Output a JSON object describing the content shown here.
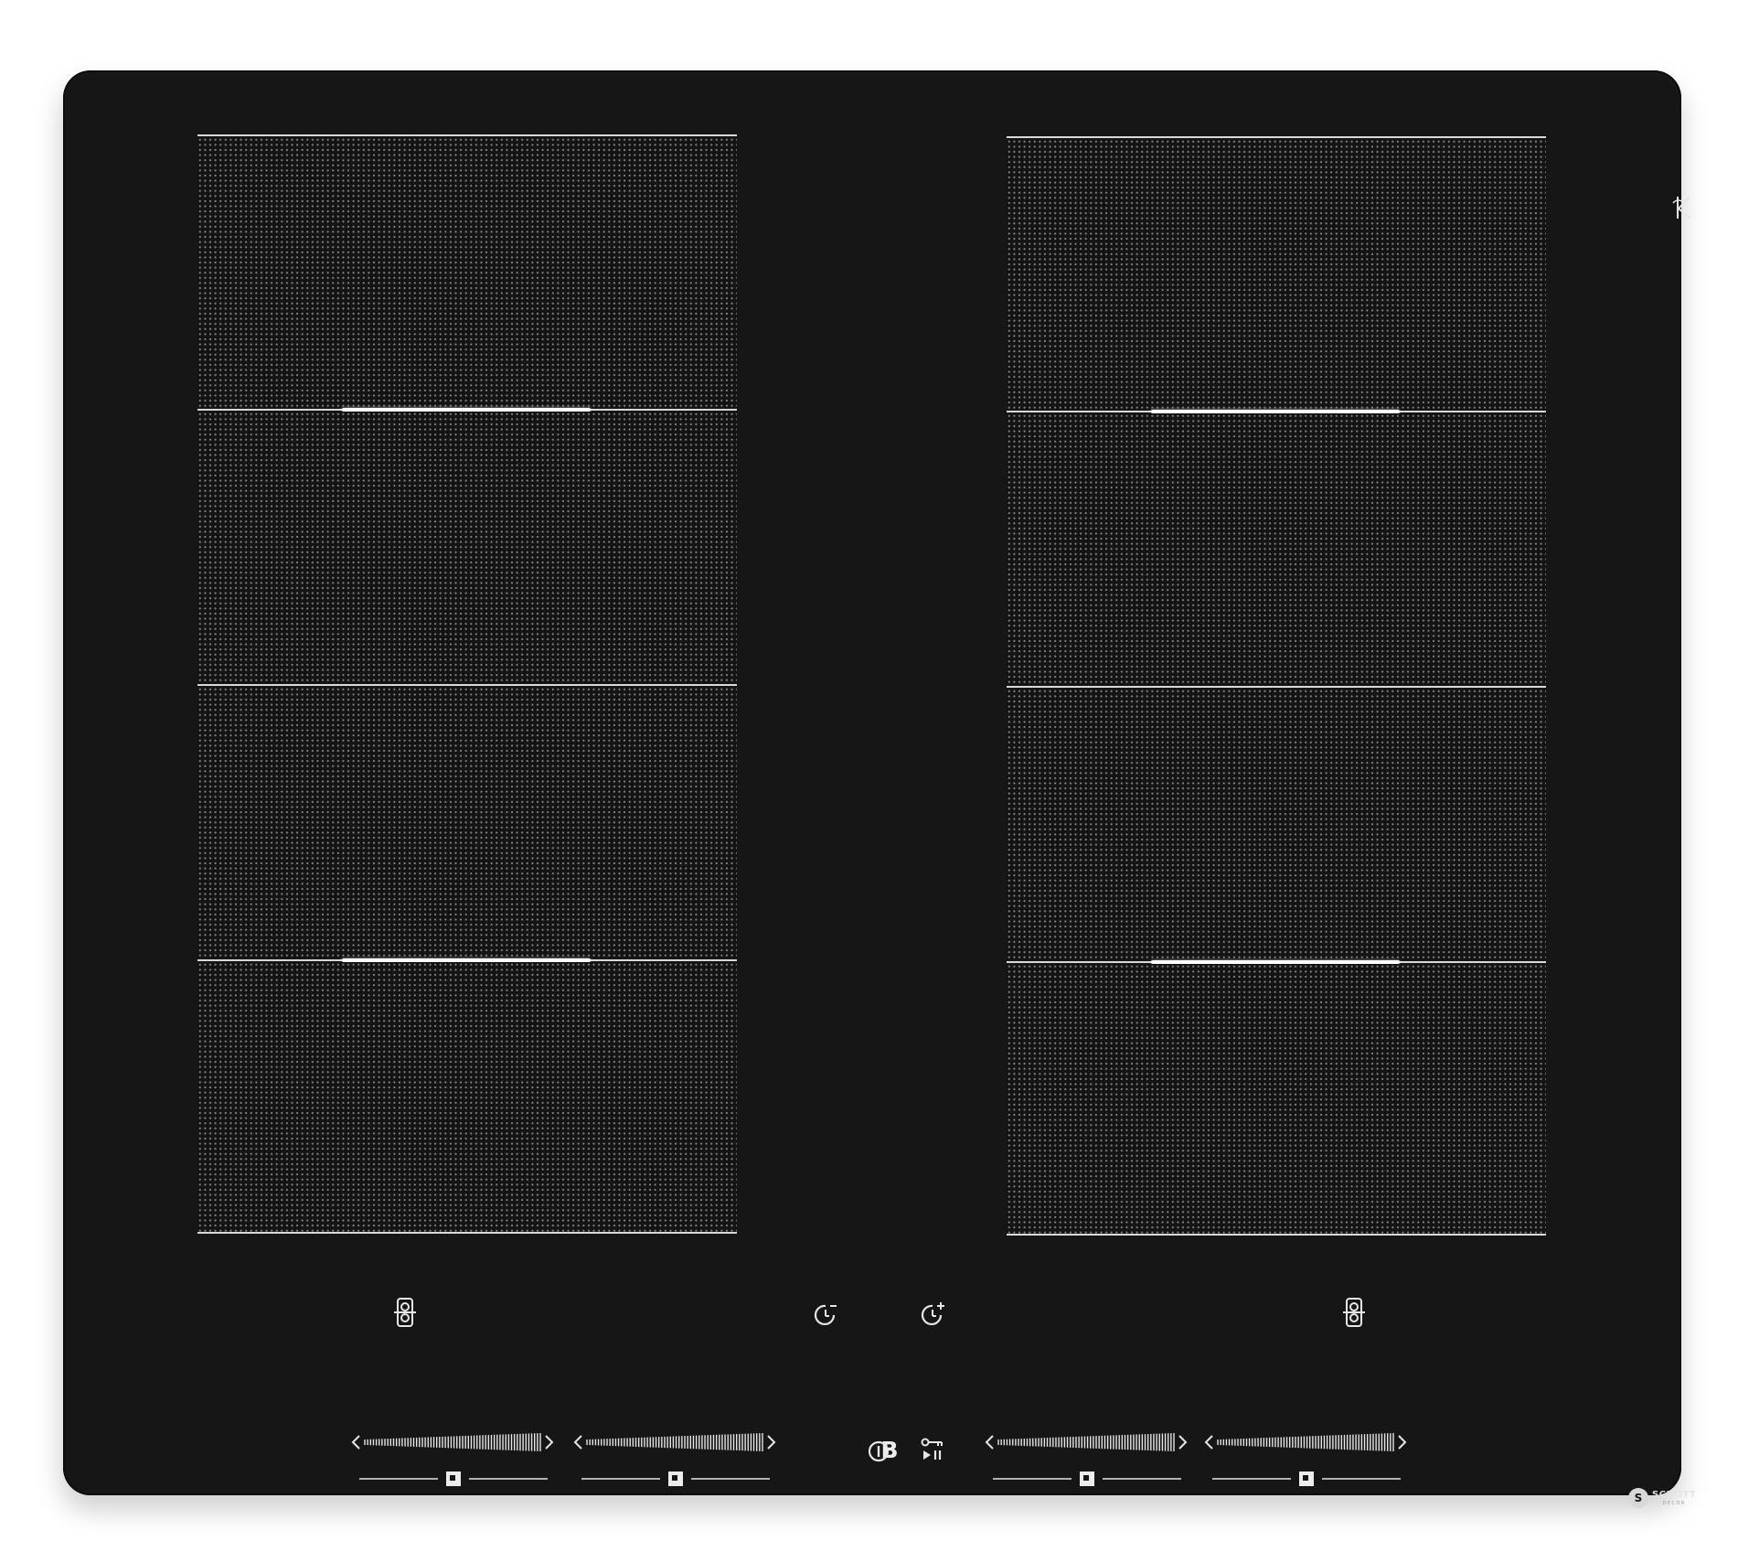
{
  "cooktop": {
    "surface_color": "#161616",
    "print_color": "#e6e6e6",
    "left_column": {
      "zone_count": 4,
      "bridge_marks_between_zones": [
        1,
        3
      ]
    },
    "right_column": {
      "zone_count": 4,
      "bridge_marks_between_zones": [
        1,
        3
      ]
    }
  },
  "controls": {
    "left_bridge_icon": "zone-bridge-icon",
    "right_bridge_icon": "zone-bridge-icon",
    "timer_minus_icon": "timer-minus-icon",
    "timer_plus_icon": "timer-plus-icon",
    "bridge_button_label": "B",
    "power_icon": "power-icon",
    "lock_pause_icon": "key-lock-play-pause-icon",
    "sliders": [
      {
        "name": "slider-zone-1",
        "left_arrow": "chevron-left-icon",
        "right_arrow": "chevron-right-icon",
        "selector": "selector-square-icon"
      },
      {
        "name": "slider-zone-2",
        "left_arrow": "chevron-left-icon",
        "right_arrow": "chevron-right-icon",
        "selector": "selector-square-icon"
      },
      {
        "name": "slider-zone-3",
        "left_arrow": "chevron-left-icon",
        "right_arrow": "chevron-right-icon",
        "selector": "selector-square-icon"
      },
      {
        "name": "slider-zone-4",
        "left_arrow": "chevron-left-icon",
        "right_arrow": "chevron-right-icon",
        "selector": "selector-square-icon"
      }
    ]
  },
  "branding": {
    "corner_logo_icon": "k-monogram-logo-icon",
    "badge_glyph": "S",
    "name": "SCHOTT",
    "subline": "DECOR"
  }
}
